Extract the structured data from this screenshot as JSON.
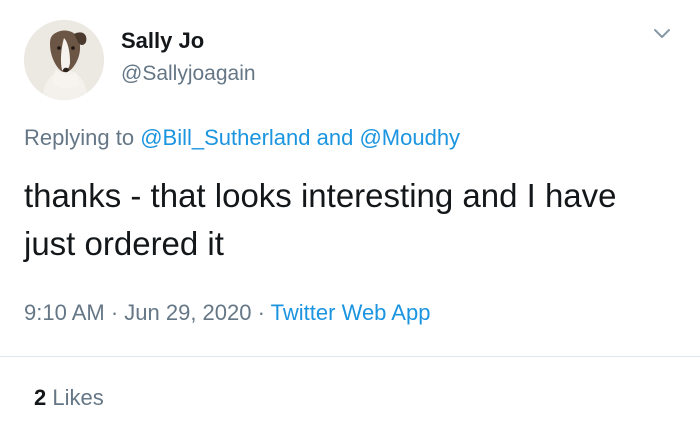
{
  "user": {
    "display_name": "Sally Jo",
    "handle": "@Sallyjoagain",
    "avatar_icon": "dog-avatar"
  },
  "reply": {
    "prefix": "Replying to ",
    "mention_1": "@Bill_Sutherland",
    "conjunction": " and ",
    "mention_2": "@Moudhy"
  },
  "tweet": {
    "text": "thanks - that looks interesting and I have just ordered it"
  },
  "meta": {
    "time": "9:10 AM",
    "separator_1": " · ",
    "date": "Jun 29, 2020",
    "separator_2": " · ",
    "source": "Twitter Web App"
  },
  "stats": {
    "likes_count": "2",
    "likes_label": " Likes"
  },
  "colors": {
    "link": "#1b95e0",
    "secondary_text": "#657786",
    "primary_text": "#14171a",
    "divider": "#e1e8ed"
  },
  "icons": {
    "menu": "chevron-down-icon"
  }
}
